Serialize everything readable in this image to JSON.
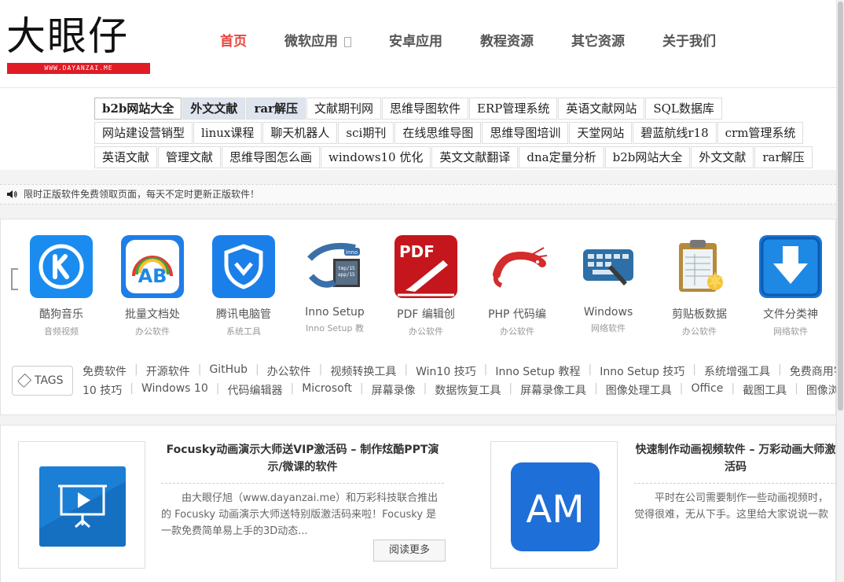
{
  "site": {
    "logo_text": "大眼仔",
    "logo_url": "WWW.DAYANZAI.ME"
  },
  "nav": [
    {
      "label": "首页",
      "active": true
    },
    {
      "label": "微软应用",
      "has_dropdown": true
    },
    {
      "label": "安卓应用"
    },
    {
      "label": "教程资源"
    },
    {
      "label": "其它资源"
    },
    {
      "label": "关于我们"
    }
  ],
  "keywords": {
    "row1": [
      "b2b网站大全",
      "外文文献",
      "rar解压",
      "文献期刊网",
      "思维导图软件",
      "ERP管理系统",
      "英语文献网站",
      "SQL数据库"
    ],
    "row2": [
      "网站建设营销型",
      "linux课程",
      "聊天机器人",
      "sci期刊",
      "在线思维导图",
      "思维导图培训",
      "天堂网站",
      "碧蓝航线r18",
      "crm管理系统"
    ],
    "row3": [
      "英语文献",
      "管理文献",
      "思维导图怎么画",
      "windows10 优化",
      "英文文献翻译",
      "dna定量分析",
      "b2b网站大全",
      "外文文献",
      "rar解压"
    ]
  },
  "notice": {
    "text": "限时正版软件免费领取页面，每天不定时更新正版软件！",
    "icon": "speaker-icon"
  },
  "apps": [
    {
      "name": "酷狗音乐",
      "category": "音频视频",
      "icon": "kugou-icon",
      "color": "#1a8cf0"
    },
    {
      "name": "批量文档处",
      "category": "办公软件",
      "icon": "ab-doc-icon",
      "color": "#1f7de8"
    },
    {
      "name": "腾讯电脑管",
      "category": "系统工具",
      "icon": "tencent-shield-icon",
      "color": "#1b7fea"
    },
    {
      "name": "Inno Setup",
      "category": "Inno Setup 教",
      "icon": "inno-setup-icon",
      "color": "#3b6fa8"
    },
    {
      "name": "PDF 编辑创",
      "category": "办公软件",
      "icon": "pdf-icon",
      "color": "#c4161c"
    },
    {
      "name": "PHP 代码编",
      "category": "办公软件",
      "icon": "shrimp-icon",
      "color": "#d42b2b"
    },
    {
      "name": "Windows",
      "category": "网络软件",
      "icon": "keyboard-icon",
      "color": "#2d6fa6"
    },
    {
      "name": "剪贴板数据",
      "category": "办公软件",
      "icon": "clipboard-icon",
      "color": "#b58a3a"
    },
    {
      "name": "文件分类神",
      "category": "网络软件",
      "icon": "download-arrow-icon",
      "color": "#1576d6"
    }
  ],
  "tags": {
    "label": "TAGS",
    "line1": [
      "免费软件",
      "开源软件",
      "GitHub",
      "办公软件",
      "视频转换工具",
      "Win10 技巧",
      "Inno Setup 教程",
      "Inno Setup 技巧",
      "系统增强工具",
      "免费商用字"
    ],
    "line2": [
      "10 技巧",
      "Windows 10",
      "代码编辑器",
      "Microsoft",
      "屏幕录像",
      "数据恢复工具",
      "屏幕录像工具",
      "图像处理工具",
      "Office",
      "截图工具",
      "图像浏"
    ]
  },
  "posts": [
    {
      "title": "Focusky动画演示大师送VIP激活码 – 制作炫酷PPT演示/微课的软件",
      "excerpt": "由大眼仔旭（www.dayanzai.me）和万彩科技联合推出的 Focusky 动画演示大师送特别版激活码来啦！Focusky 是一款免费简单易上手的3D动态...",
      "read_more": "阅读更多",
      "icon": "focusky-presentation-icon",
      "color": "#1c7fd6"
    },
    {
      "title": "快速制作动画视频软件 – 万彩动画大师激活码",
      "excerpt": "平时在公司需要制作一些动画视频时，觉得很难，无从下手。这里给大家说说一款动画视频制作利器——万彩动画大师...",
      "icon": "am-icon",
      "icon_text": "AM",
      "color": "#1f6fd8"
    }
  ]
}
